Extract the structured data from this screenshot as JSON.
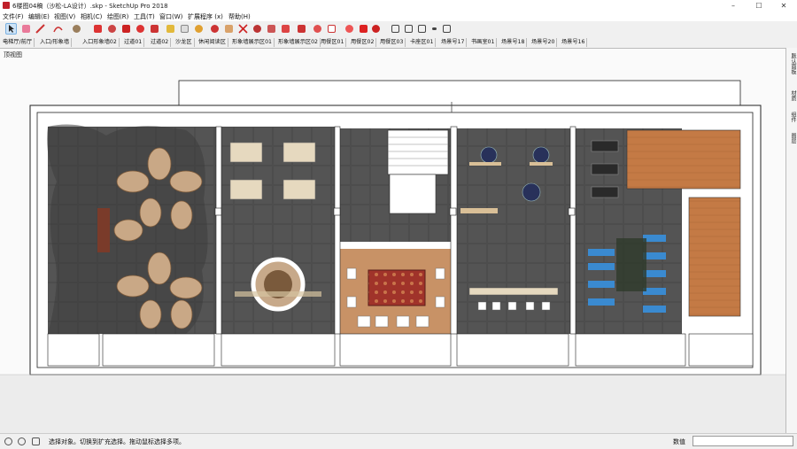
{
  "window": {
    "title": "6楼图04稿（沙松-LA设计）.skp - SketchUp Pro 2018",
    "minimize": "–",
    "maximize": "☐",
    "close": "✕"
  },
  "menu": [
    "文件(F)",
    "编辑(E)",
    "视图(V)",
    "相机(C)",
    "绘图(R)",
    "工具(T)",
    "窗口(W)",
    "扩展程序 (x)",
    "帮助(H)"
  ],
  "scenes": [
    "电梯厅/前厅",
    "入口/形象墙",
    "入口形象墙02",
    "过道01",
    "过道02",
    "沙龙区",
    "休闲阅读区",
    "形象墙展示区01",
    "形象墙展示区02",
    "用餐区01",
    "用餐区02",
    "用餐区03",
    "卡座区01",
    "场景号17",
    "书画室01",
    "场景号18",
    "场景号20",
    "场景号16"
  ],
  "viewport_label": "顶视图",
  "right_panel": [
    "默认面板",
    "材质",
    "组件",
    "图层"
  ],
  "status": {
    "hint": "选择对象。切换到扩充选择。拖动鼠标选择多项。",
    "measure_label": "数值",
    "measure_value": ""
  },
  "colors": {
    "accent_red": "#c0202a",
    "floor_dark": "#4b4b4b",
    "wood": "#c47a45",
    "selected_tool": "#cde3f7"
  }
}
